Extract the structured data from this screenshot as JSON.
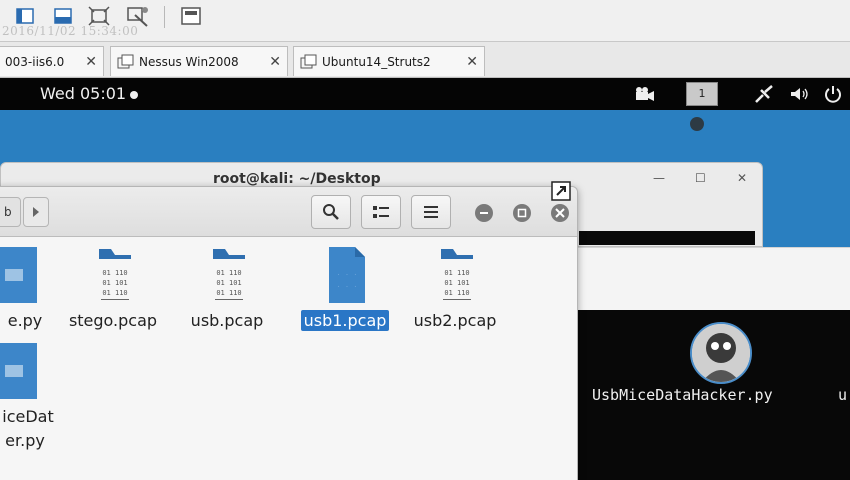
{
  "vm": {
    "watermark": "2016/11/02 15:34:00",
    "toolbar": [
      "fullscreen-icon",
      "unity-icon",
      "fit-guest-icon",
      "autofit-icon",
      "console-view-icon"
    ],
    "tabs": [
      {
        "label": "003-iis6.0"
      },
      {
        "label": "Nessus Win2008"
      },
      {
        "label": "Ubuntu14_Struts2"
      }
    ]
  },
  "topbar": {
    "clock": "Wed 05:01",
    "workspace": "1"
  },
  "bg_window": {
    "title": "root@kali: ~/Desktop"
  },
  "files": {
    "items": [
      {
        "label": "e.py",
        "kind": "script"
      },
      {
        "label": "stego.pcap",
        "kind": "pcap"
      },
      {
        "label": "usb.pcap",
        "kind": "pcap"
      },
      {
        "label": "usb1.pcap",
        "kind": "pcap",
        "selected": true
      },
      {
        "label": "usb2.pcap",
        "kind": "pcap"
      },
      {
        "label_line1": "iceDat",
        "label_line2": "er.py",
        "kind": "script"
      }
    ]
  },
  "desktop": {
    "icon_label": "UsbMiceDataHacker.py",
    "icon_label_cut": "u"
  },
  "colors": {
    "desktop_blue": "#2a7fc0",
    "selection": "#2a76c6",
    "file_blue": "#3d86c9"
  }
}
